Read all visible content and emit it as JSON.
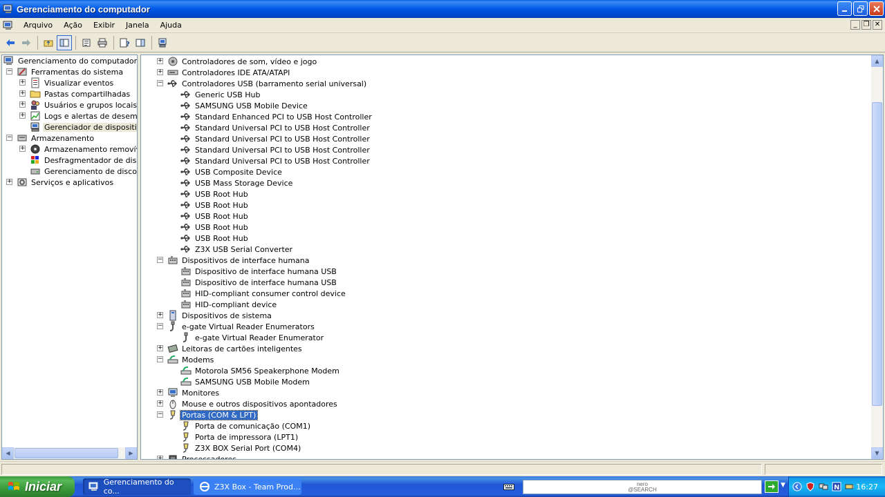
{
  "window": {
    "title": "Gerenciamento do computador"
  },
  "menu": [
    "Arquivo",
    "Ação",
    "Exibir",
    "Janela",
    "Ajuda"
  ],
  "left_tree": [
    {
      "label": "Gerenciamento do computador (loca",
      "level": 0,
      "expander": "",
      "icon": "computer"
    },
    {
      "label": "Ferramentas do sistema",
      "level": 1,
      "expander": "-",
      "icon": "tools"
    },
    {
      "label": "Visualizar eventos",
      "level": 2,
      "expander": "+",
      "icon": "event"
    },
    {
      "label": "Pastas compartilhadas",
      "level": 2,
      "expander": "+",
      "icon": "folder"
    },
    {
      "label": "Usuários e grupos locais",
      "level": 2,
      "expander": "+",
      "icon": "users"
    },
    {
      "label": "Logs e alertas de desempen",
      "level": 2,
      "expander": "+",
      "icon": "perf"
    },
    {
      "label": "Gerenciador de dispositivos",
      "level": 2,
      "expander": "",
      "icon": "devmgr",
      "selected": true
    },
    {
      "label": "Armazenamento",
      "level": 1,
      "expander": "-",
      "icon": "storage"
    },
    {
      "label": "Armazenamento removível",
      "level": 2,
      "expander": "+",
      "icon": "removable"
    },
    {
      "label": "Desfragmentador de disco",
      "level": 2,
      "expander": "",
      "icon": "defrag"
    },
    {
      "label": "Gerenciamento de disco",
      "level": 2,
      "expander": "",
      "icon": "disk"
    },
    {
      "label": "Serviços e aplicativos",
      "level": 1,
      "expander": "+",
      "icon": "services"
    }
  ],
  "device_tree": [
    {
      "label": "Controladores de som, vídeo e jogo",
      "level": 0,
      "expander": "+",
      "icon": "sound"
    },
    {
      "label": "Controladores IDE ATA/ATAPI",
      "level": 0,
      "expander": "+",
      "icon": "ide"
    },
    {
      "label": "Controladores USB (barramento serial universal)",
      "level": 0,
      "expander": "-",
      "icon": "usb"
    },
    {
      "label": "Generic USB Hub",
      "level": 1,
      "icon": "usb"
    },
    {
      "label": "SAMSUNG USB Mobile Device",
      "level": 1,
      "icon": "usb"
    },
    {
      "label": "Standard Enhanced PCI to USB Host Controller",
      "level": 1,
      "icon": "usb"
    },
    {
      "label": "Standard Universal PCI to USB Host Controller",
      "level": 1,
      "icon": "usb"
    },
    {
      "label": "Standard Universal PCI to USB Host Controller",
      "level": 1,
      "icon": "usb"
    },
    {
      "label": "Standard Universal PCI to USB Host Controller",
      "level": 1,
      "icon": "usb"
    },
    {
      "label": "Standard Universal PCI to USB Host Controller",
      "level": 1,
      "icon": "usb"
    },
    {
      "label": "USB Composite Device",
      "level": 1,
      "icon": "usb"
    },
    {
      "label": "USB Mass Storage Device",
      "level": 1,
      "icon": "usb"
    },
    {
      "label": "USB Root Hub",
      "level": 1,
      "icon": "usb"
    },
    {
      "label": "USB Root Hub",
      "level": 1,
      "icon": "usb"
    },
    {
      "label": "USB Root Hub",
      "level": 1,
      "icon": "usb"
    },
    {
      "label": "USB Root Hub",
      "level": 1,
      "icon": "usb"
    },
    {
      "label": "USB Root Hub",
      "level": 1,
      "icon": "usb"
    },
    {
      "label": "Z3X USB Serial Converter",
      "level": 1,
      "icon": "usb"
    },
    {
      "label": "Dispositivos de interface humana",
      "level": 0,
      "expander": "-",
      "icon": "hid"
    },
    {
      "label": "Dispositivo de interface humana USB",
      "level": 1,
      "icon": "hid"
    },
    {
      "label": "Dispositivo de interface humana USB",
      "level": 1,
      "icon": "hid"
    },
    {
      "label": "HID-compliant consumer control device",
      "level": 1,
      "icon": "hid"
    },
    {
      "label": "HID-compliant device",
      "level": 1,
      "icon": "hid"
    },
    {
      "label": "Dispositivos de sistema",
      "level": 0,
      "expander": "+",
      "icon": "system"
    },
    {
      "label": "e-gate Virtual Reader Enumerators",
      "level": 0,
      "expander": "-",
      "icon": "plug"
    },
    {
      "label": "e-gate Virtual Reader Enumerator",
      "level": 1,
      "icon": "plug"
    },
    {
      "label": "Leitoras de cartões inteligentes",
      "level": 0,
      "expander": "+",
      "icon": "card"
    },
    {
      "label": "Modems",
      "level": 0,
      "expander": "-",
      "icon": "modem"
    },
    {
      "label": "Motorola SM56 Speakerphone Modem",
      "level": 1,
      "icon": "modem"
    },
    {
      "label": "SAMSUNG USB Mobile Modem",
      "level": 1,
      "icon": "modem"
    },
    {
      "label": "Monitores",
      "level": 0,
      "expander": "+",
      "icon": "monitor"
    },
    {
      "label": "Mouse e outros dispositivos apontadores",
      "level": 0,
      "expander": "+",
      "icon": "mouse"
    },
    {
      "label": "Portas (COM & LPT)",
      "level": 0,
      "expander": "-",
      "icon": "port",
      "selected": true
    },
    {
      "label": "Porta de comunicação (COM1)",
      "level": 1,
      "icon": "port"
    },
    {
      "label": "Porta de impressora (LPT1)",
      "level": 1,
      "icon": "port"
    },
    {
      "label": "Z3X BOX Serial Port (COM4)",
      "level": 1,
      "icon": "port"
    },
    {
      "label": "Processadores",
      "level": 0,
      "expander": "+",
      "icon": "cpu"
    }
  ],
  "taskbar": {
    "start_label": "Iniciar",
    "items": [
      {
        "label": "Gerenciamento do co...",
        "active": true
      },
      {
        "label": "Z3X Box - Team Prod...",
        "active": false
      }
    ],
    "search_brand_top": "nero",
    "search_brand_bottom": "@SEARCH",
    "clock": "16:27"
  },
  "colors": {
    "selection": "#316ac5",
    "titlebar": "#0058e6",
    "taskbar": "#245edb",
    "start": "#3a9a3a"
  }
}
